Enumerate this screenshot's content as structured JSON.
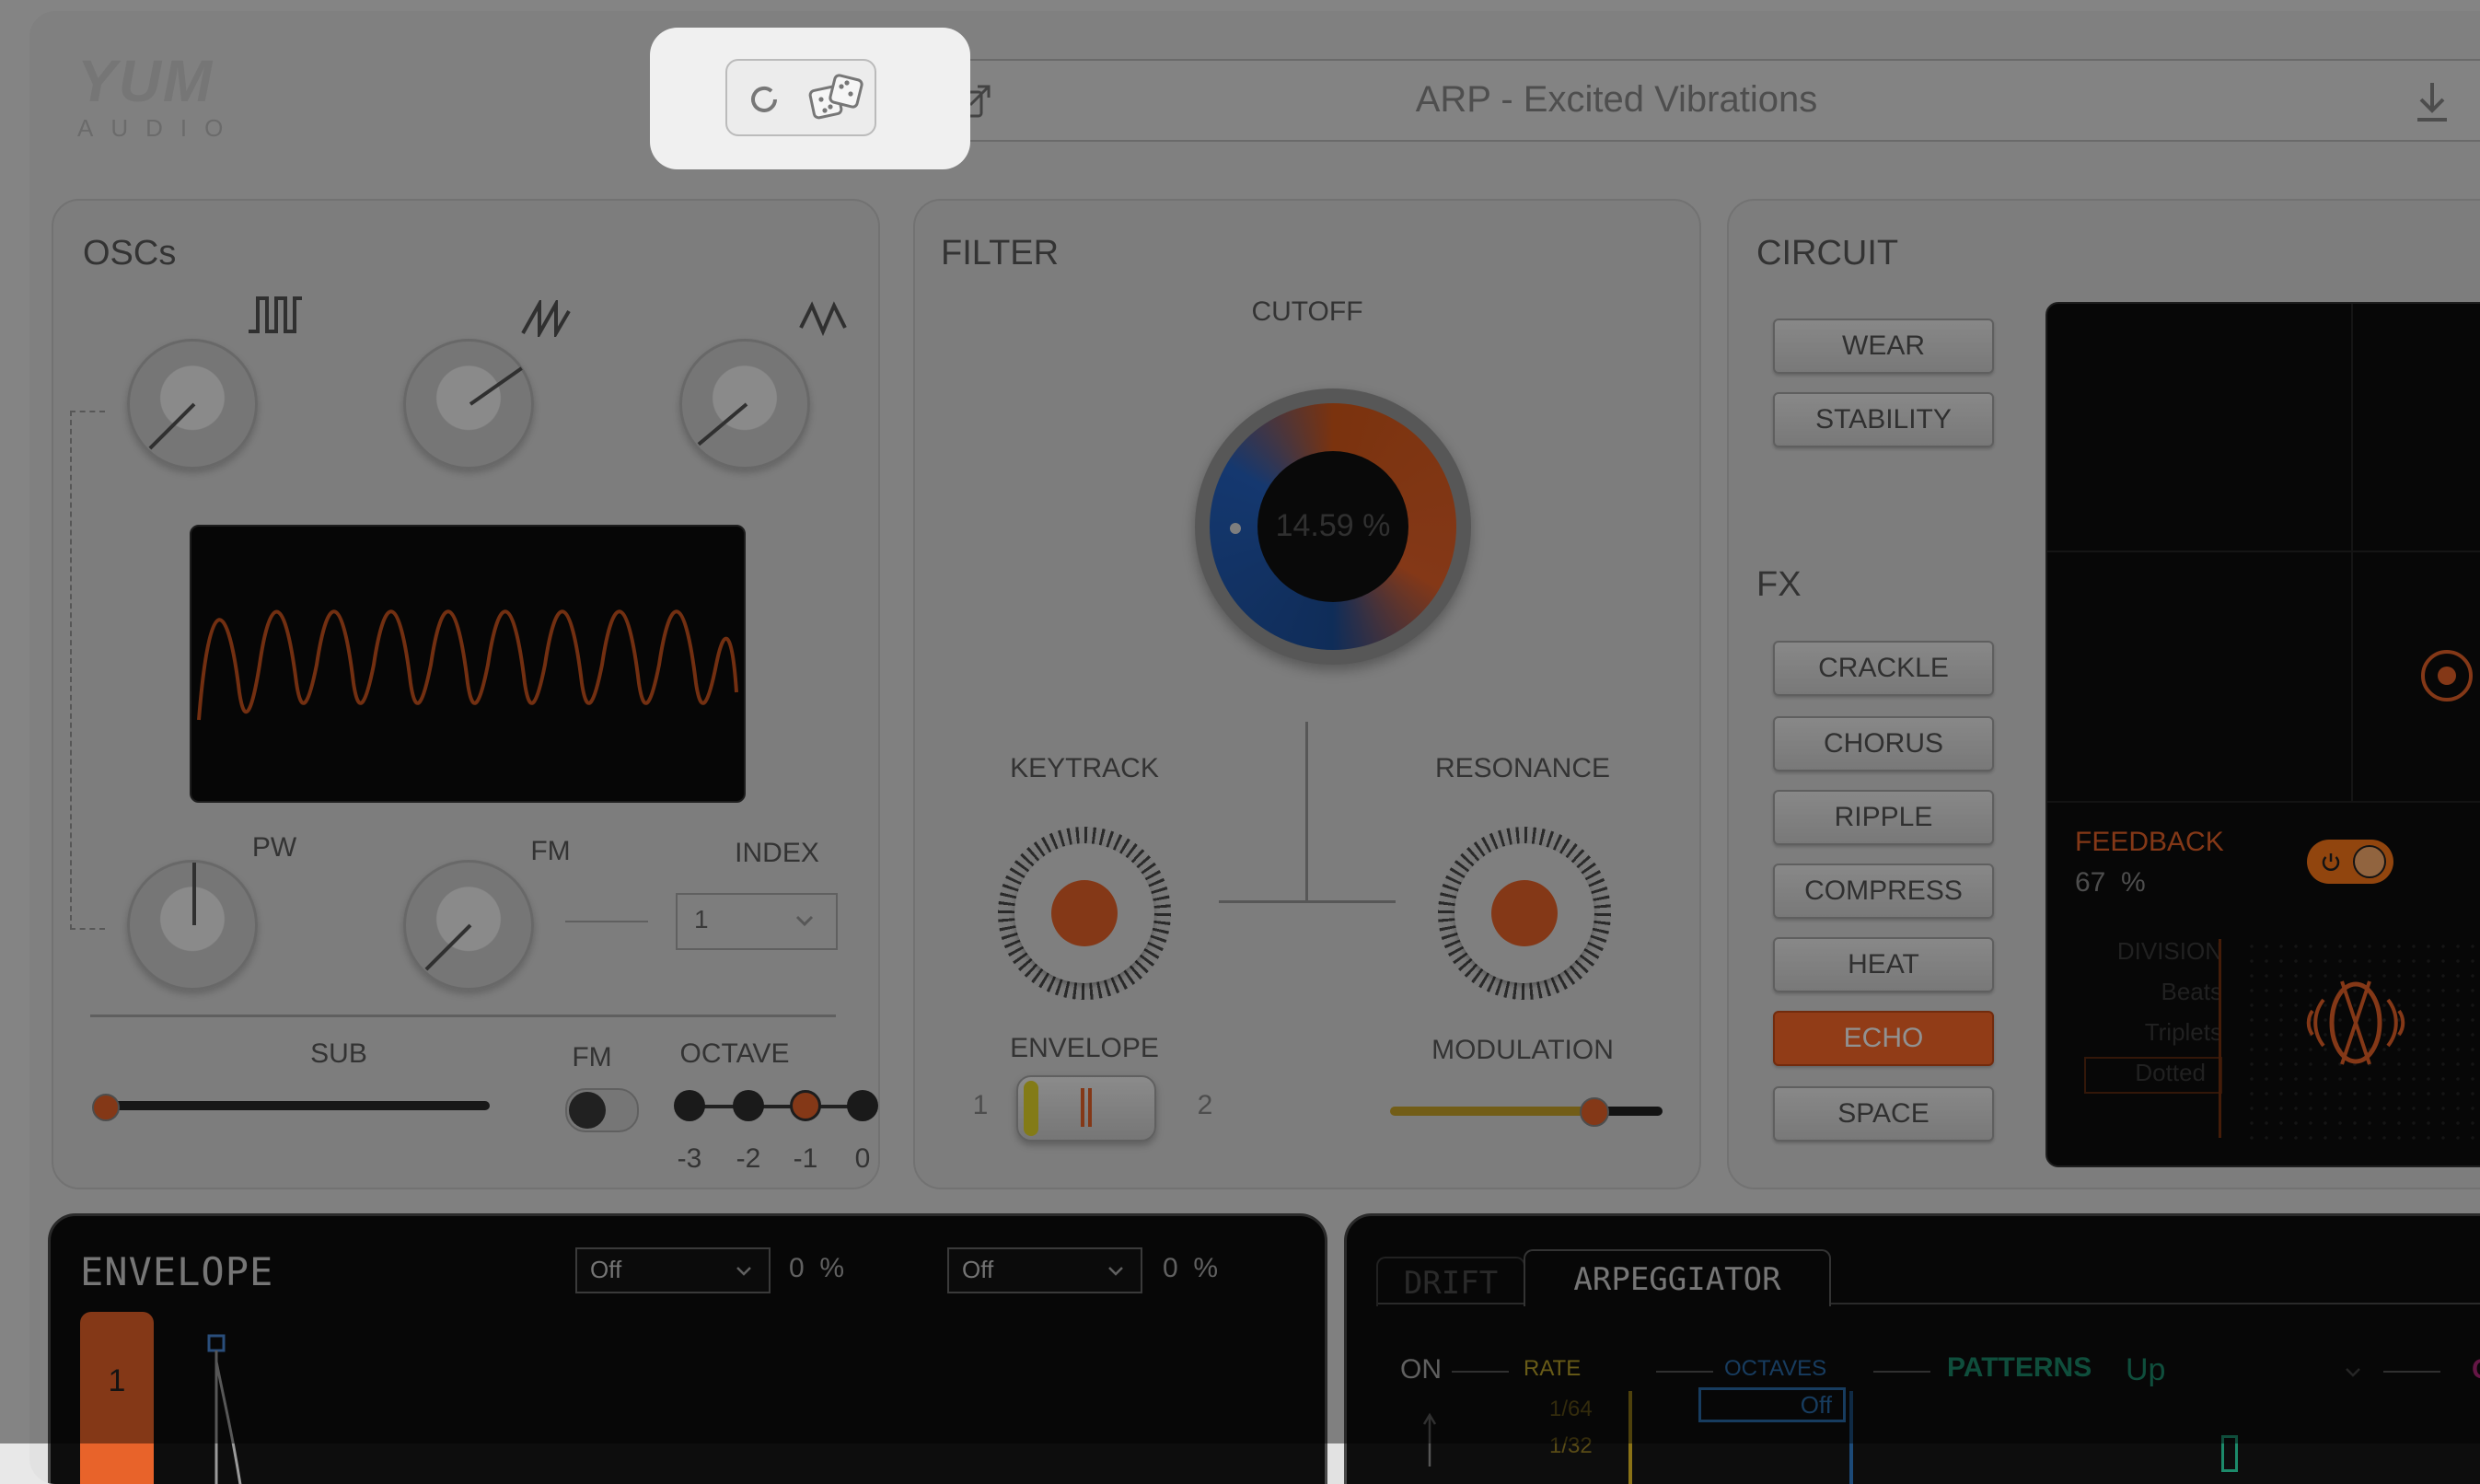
{
  "brand": {
    "logo_top": "YUM",
    "logo_bottom": "AUDIO"
  },
  "toolbar": {
    "preset_name": "ARP - Excited Vibrations"
  },
  "oscs": {
    "title": "OSCs",
    "pw_label": "PW",
    "fm_label": "FM",
    "index_label": "INDEX",
    "index_value": "1",
    "sub_label": "SUB",
    "fm_toggle_label": "FM",
    "octave_label": "OCTAVE",
    "octave_ticks": [
      "-3",
      "-2",
      "-1",
      "0"
    ],
    "octave_selected": "-1"
  },
  "filter": {
    "title": "FILTER",
    "cutoff_label": "CUTOFF",
    "cutoff_value": "14.59 %",
    "keytrack_label": "KEYTRACK",
    "resonance_label": "RESONANCE",
    "envelope_label": "ENVELOPE",
    "env_left": "1",
    "env_right": "2",
    "modulation_label": "MODULATION"
  },
  "circuit": {
    "title": "CIRCUIT",
    "wear": "WEAR",
    "stability": "STABILITY",
    "fx_title": "FX",
    "fx": [
      "CRACKLE",
      "CHORUS",
      "RIPPLE",
      "COMPRESS",
      "HEAT",
      "ECHO",
      "SPACE"
    ],
    "fx_active": "ECHO"
  },
  "echo": {
    "feedback_label": "FEEDBACK",
    "feedback_value": "67",
    "feedback_unit": "%",
    "division_label": "DIVISION",
    "division_options": [
      "Beats",
      "Triplets",
      "Dotted"
    ]
  },
  "envelope": {
    "title": "ENVELOPE",
    "slot": "1",
    "mod1_select": "Off",
    "mod1_value": "0",
    "mod1_unit": "%",
    "mod2_select": "Off",
    "mod2_value": "0",
    "mod2_unit": "%"
  },
  "arp": {
    "tab_drift": "DRIFT",
    "tab_arp": "ARPEGGIATOR",
    "on": "ON",
    "rate": "RATE",
    "rate_values": [
      "1/64",
      "1/32"
    ],
    "octaves": "OCTAVES",
    "octaves_value": "Off",
    "patterns": "PATTERNS",
    "pattern_value": "Up",
    "chords_label": "CH"
  },
  "colors": {
    "accent": "#e8632a",
    "accent_bright": "#ff6a2a",
    "cutoff_blue": "#1c4f9c"
  }
}
